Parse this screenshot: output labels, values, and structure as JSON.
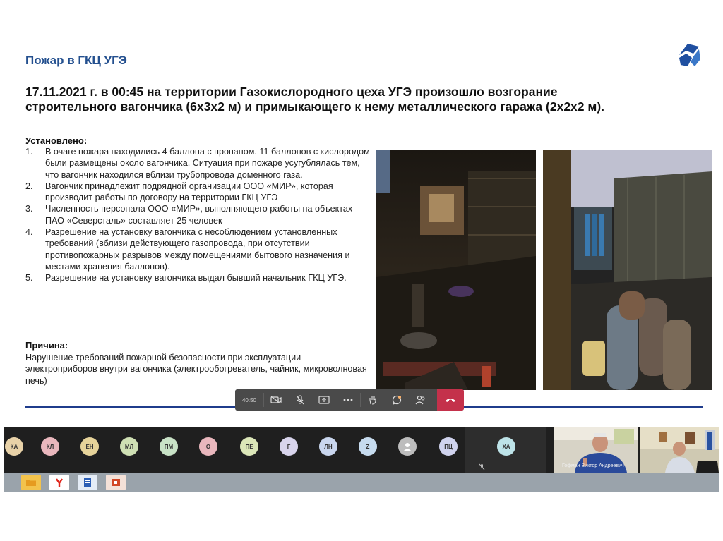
{
  "slide": {
    "title": "Пожар в ГКЦ УГЭ",
    "headline_line1": "17.11.2021 г. в 00:45 на территории Газокислородного цеха УГЭ произошло возгорание",
    "headline_line2": "строительного вагончика (6х3х2 м) и примыкающего к нему металлического гаража (2х2х2 м).",
    "established_heading": "Установлено:",
    "items": [
      {
        "num": "1.",
        "text": "В очаге пожара находились 4 баллона с пропаном. 11 баллонов с кислородом были размещены около вагончика. Ситуация при пожаре усугублялась тем, что вагончик находился вблизи трубопровода доменного газа."
      },
      {
        "num": "2.",
        "text": "Вагончик принадлежит подрядной организации ООО «МИР», которая производит работы по договору на территории ГКЦ УГЭ"
      },
      {
        "num": "3.",
        "text": "Численность персонала ООО «МИР», выполняющего работы на объектах ПАО «Северсталь» составляет 25 человек"
      },
      {
        "num": "4.",
        "text": "Разрешение на установку вагончика с несоблюдением установленных требований (вблизи действующего газопровода, при отсутствии противопожарных разрывов между помещениями бытового назначения и местами хранения баллонов)."
      },
      {
        "num": "5.",
        "text": "Разрешение на установку вагончика выдал бывший начальник ГКЦ УГЭ."
      }
    ],
    "cause_heading": "Причина:",
    "cause_text": "Нарушение требований пожарной безопасности при эксплуатации электроприборов внутри вагончика (электрообогреватель, чайник, микроволновая печь)",
    "brand_color": "#24508f",
    "rule_color": "#1f3c8c"
  },
  "toolbar": {
    "timer": "40:50",
    "hangup_color": "#c4314b",
    "buttons": [
      "camera-off-icon",
      "mic-off-icon",
      "share-screen-icon",
      "more-icon",
      "raise-hand-icon",
      "chat-icon",
      "participants-icon",
      "hang-up-icon"
    ]
  },
  "participants": [
    {
      "initials": "КА",
      "color": "#e8d2a8"
    },
    {
      "initials": "КЛ",
      "color": "#e9b7bd"
    },
    {
      "initials": "ЕН",
      "color": "#e6d39a"
    },
    {
      "initials": "МЛ",
      "color": "#cfe0b4"
    },
    {
      "initials": "ПМ",
      "color": "#c8e2c6"
    },
    {
      "initials": "О",
      "color": "#e9b7bd"
    },
    {
      "initials": "ПЕ",
      "color": "#dbe6b8"
    },
    {
      "initials": "Г",
      "color": "#d8d4ec"
    },
    {
      "initials": "ЛН",
      "color": "#c9d6ee"
    },
    {
      "initials": "Z",
      "color": "#c6dbee"
    },
    {
      "initials": "",
      "color": "#bdbdbd"
    },
    {
      "initials": "ПЦ",
      "color": "#d0d3ee"
    }
  ],
  "self_participant": {
    "initials": "ХА",
    "color": "#bde3e8"
  },
  "camera_name": "Гофман Виктор Андреевич",
  "taskbar_icons": [
    "folder-icon",
    "yandex-browser-icon",
    "document-icon",
    "presentation-icon"
  ]
}
